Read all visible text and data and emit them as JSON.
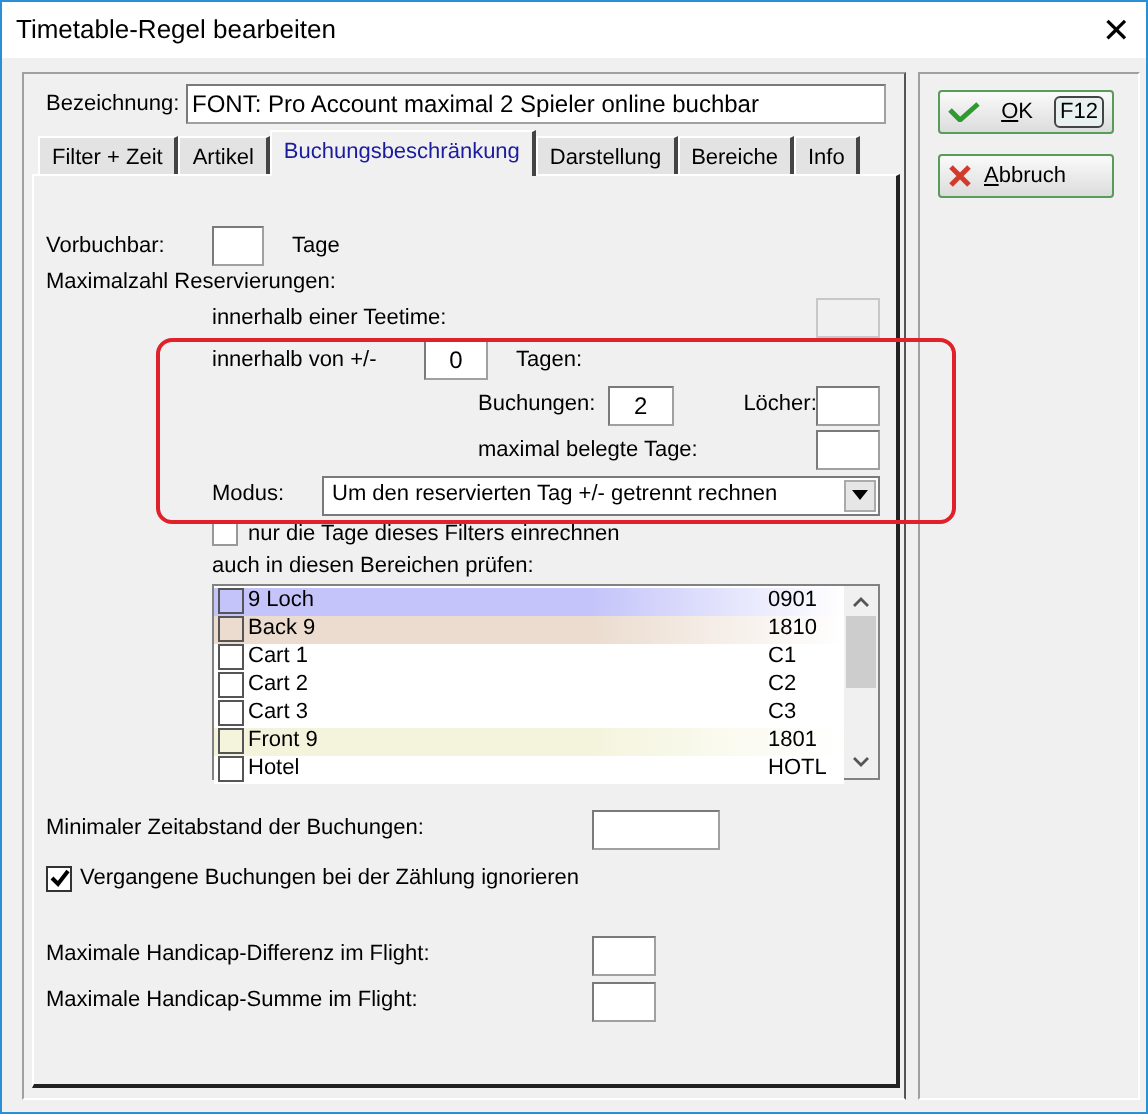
{
  "window": {
    "title": "Timetable-Regel bearbeiten",
    "close": "✕"
  },
  "bezeichnung": {
    "label": "Bezeichnung:",
    "value": "FONT: Pro Account maximal 2 Spieler online buchbar"
  },
  "tabs": [
    {
      "label": "Filter + Zeit",
      "selected": false
    },
    {
      "label": "Artikel",
      "selected": false
    },
    {
      "label": "Buchungsbeschränkung",
      "selected": true
    },
    {
      "label": "Darstellung",
      "selected": false
    },
    {
      "label": "Bereiche",
      "selected": false
    },
    {
      "label": "Info",
      "selected": false
    }
  ],
  "vorbuchbar": {
    "label": "Vorbuchbar:",
    "unit": "Tage"
  },
  "maximalzahl": {
    "label": "Maximalzahl Reservierungen:"
  },
  "teetime": {
    "label": "innerhalb einer Teetime:",
    "disabled": true
  },
  "tage_range": {
    "label": "innerhalb von +/-",
    "value": "0",
    "unit": "Tagen:"
  },
  "buchungen": {
    "label": "Buchungen:",
    "value": "2"
  },
  "loecher": {
    "label": "Löcher:"
  },
  "belegte_tage": {
    "label": "maximal belegte Tage:"
  },
  "modus": {
    "label": "Modus:",
    "value": "Um den reservierten Tag +/- getrennt rechnen"
  },
  "nur_filter_tage": {
    "label": "nur die Tage dieses Filters einrechnen",
    "checked": false
  },
  "bereiche": {
    "label": "auch in diesen Bereichen prüfen:",
    "items": [
      {
        "name": "9 Loch",
        "code": "0901",
        "checked": false,
        "color": "#c4c4fa"
      },
      {
        "name": "Back 9",
        "code": "1810",
        "checked": false,
        "color": "#ebdccf"
      },
      {
        "name": "Cart 1",
        "code": "C1",
        "checked": false,
        "color": "#ffffff"
      },
      {
        "name": "Cart 2",
        "code": "C2",
        "checked": false,
        "color": "#ffffff"
      },
      {
        "name": "Cart 3",
        "code": "C3",
        "checked": false,
        "color": "#ffffff"
      },
      {
        "name": "Front 9",
        "code": "1801",
        "checked": false,
        "color": "#f4f4dd"
      },
      {
        "name": "Hotel",
        "code": "HOTL",
        "checked": false,
        "color": "#ffffff"
      }
    ]
  },
  "min_zeitabstand": {
    "label": "Minimaler Zeitabstand der Buchungen:"
  },
  "vergangene": {
    "label": "Vergangene Buchungen bei der Zählung ignorieren",
    "checked": true
  },
  "handicap_differenz": {
    "label": "Maximale Handicap-Differenz im Flight:"
  },
  "handicap_summe": {
    "label": "Maximale Handicap-Summe im Flight:"
  },
  "buttons": [
    {
      "kind": "ok",
      "label": "OK",
      "shortcut": "F12"
    },
    {
      "kind": "cancel",
      "label": "Abbruch"
    }
  ]
}
